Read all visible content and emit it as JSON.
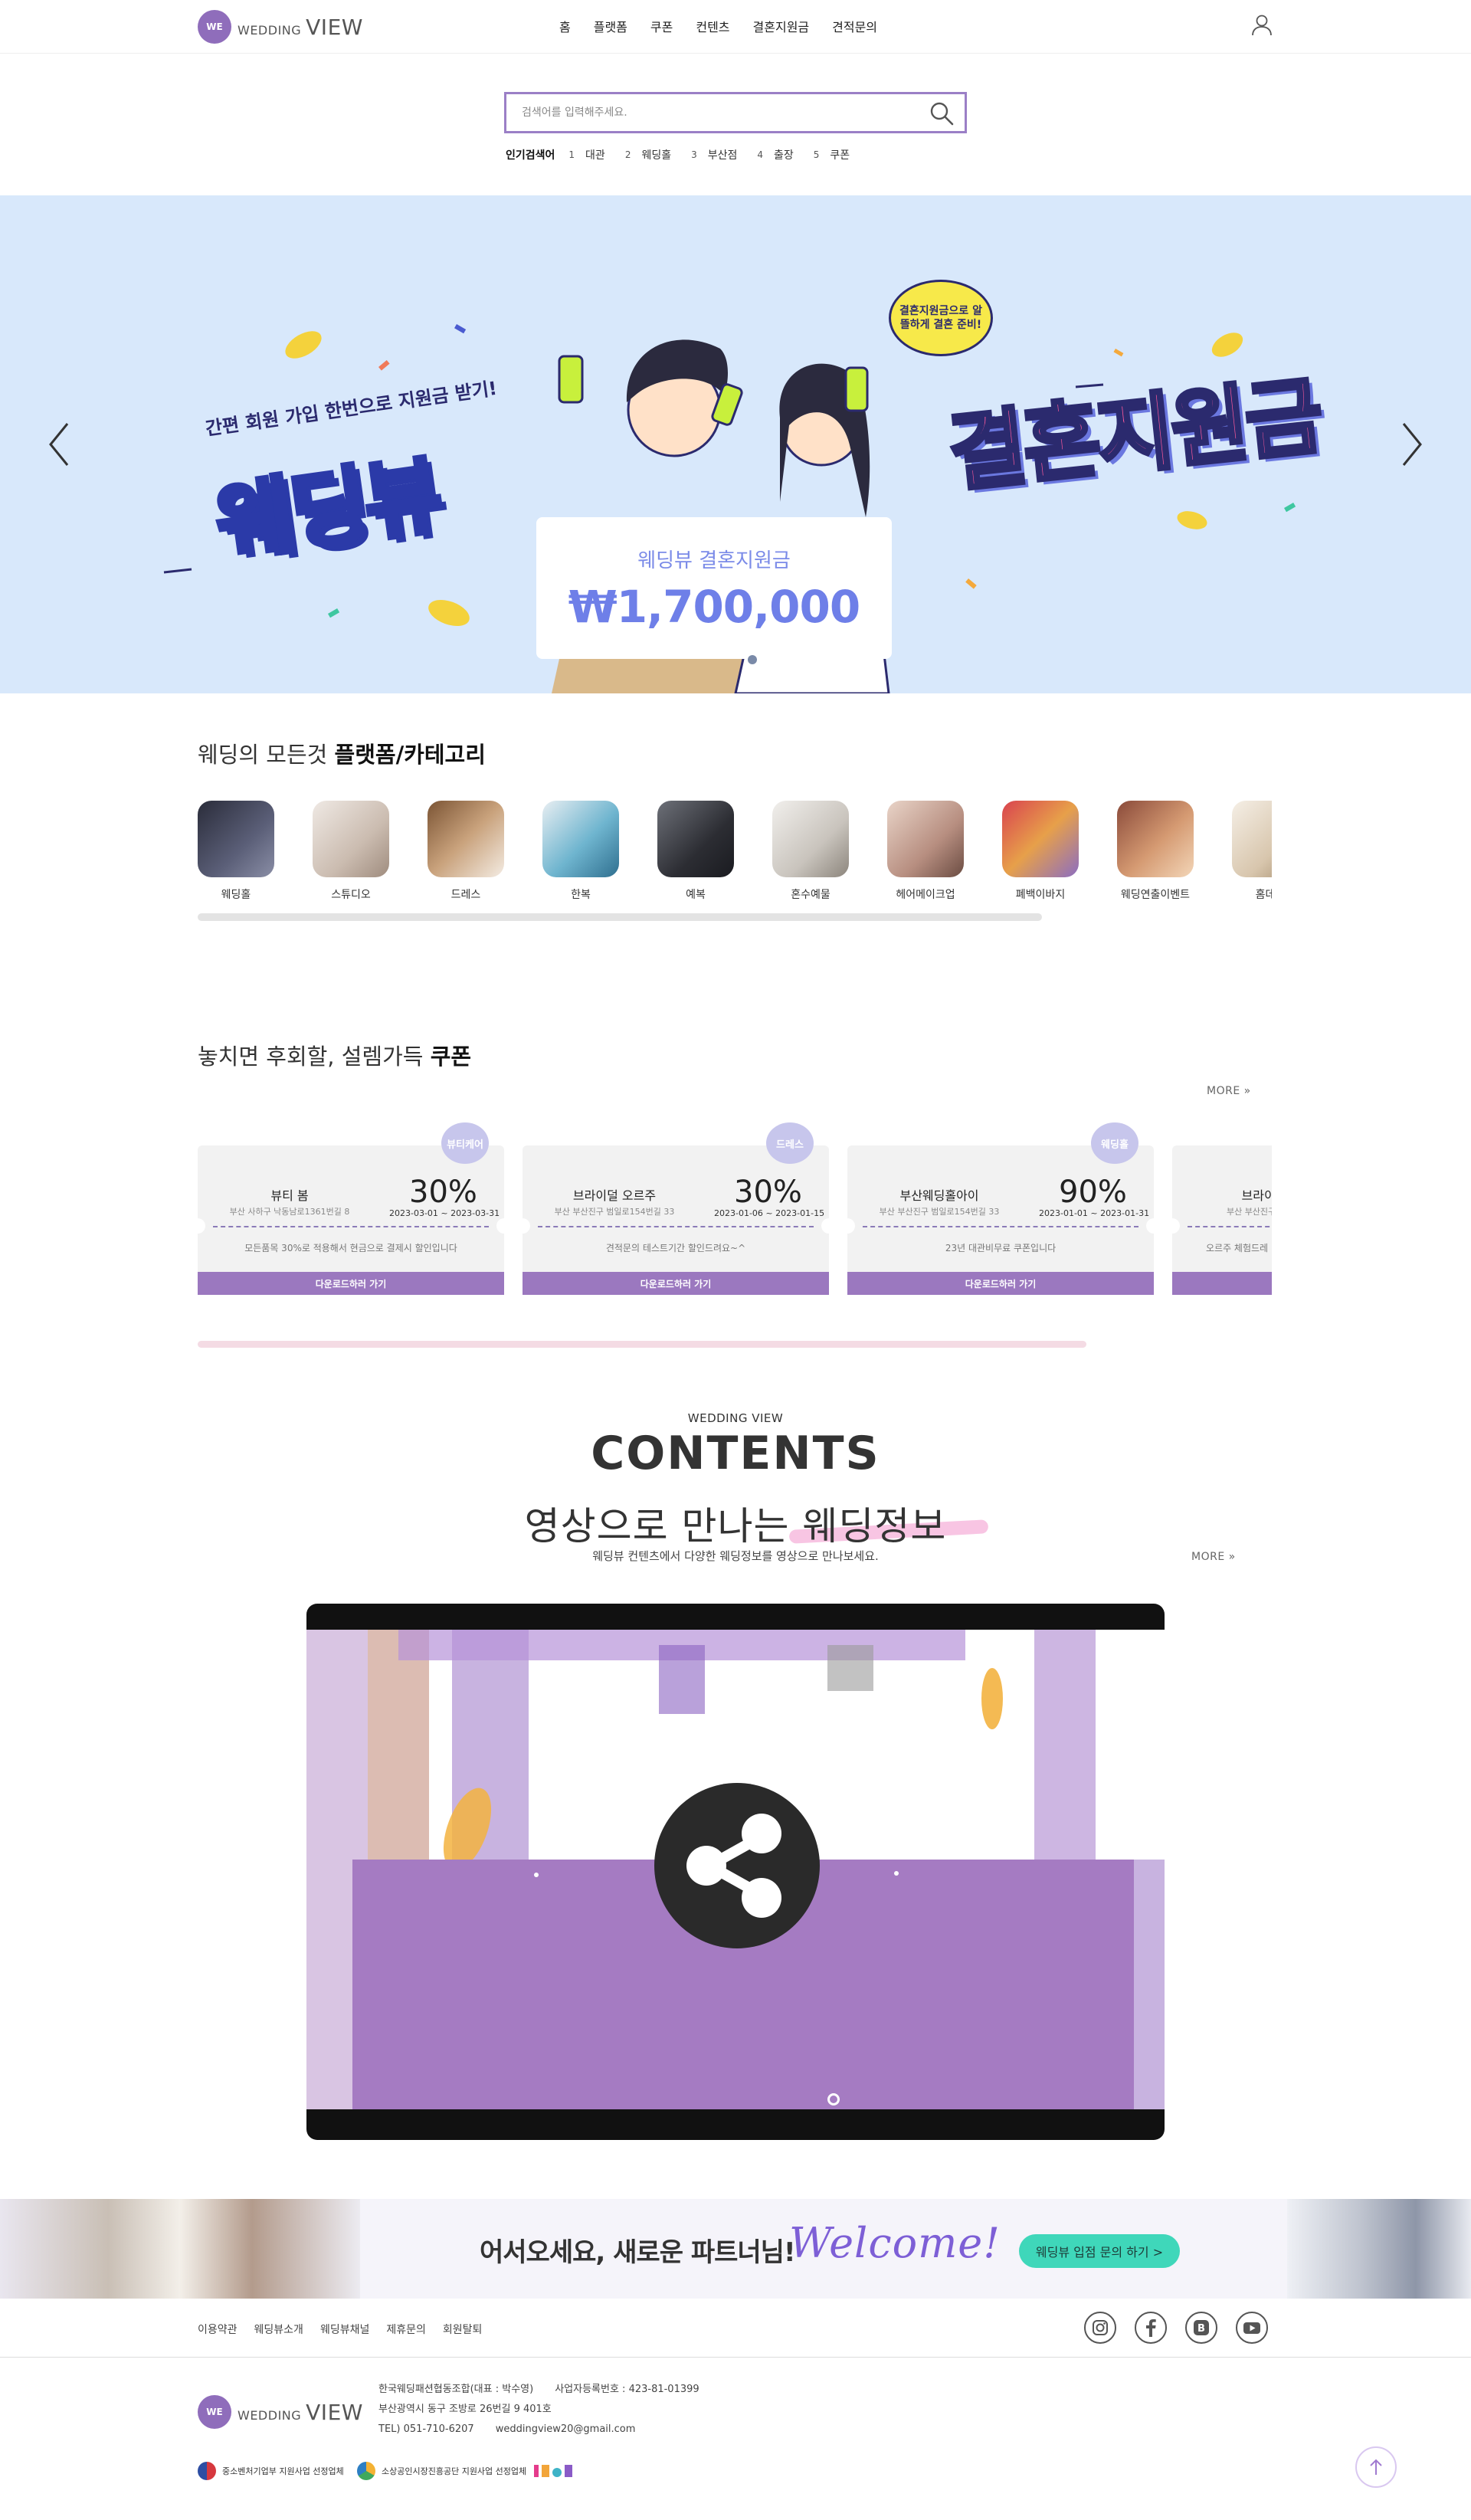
{
  "header": {
    "logo_mark": "WE",
    "logo_word_1": "WEDDING",
    "logo_word_2": "VIEW",
    "nav": [
      "홈",
      "플랫폼",
      "쿠폰",
      "컨텐츠",
      "결혼지원금",
      "견적문의"
    ]
  },
  "search": {
    "placeholder": "검색어를 입력해주세요.",
    "popular_label": "인기검색어",
    "keywords": [
      {
        "rank": "1",
        "text": "대관"
      },
      {
        "rank": "2",
        "text": "웨딩홀"
      },
      {
        "rank": "3",
        "text": "부산점"
      },
      {
        "rank": "4",
        "text": "출장"
      },
      {
        "rank": "5",
        "text": "쿠폰"
      }
    ]
  },
  "hero": {
    "subtitle": "간편 회원 가입 한번으로 지원금 받기!",
    "title_left": "웨딩뷰",
    "title_right": "결혼지원금",
    "bubble": "결혼지원금으로 알뜰하게 결혼 준비!",
    "ticket_label": "웨딩뷰 결혼지원금",
    "ticket_amount": "₩1,700,000",
    "colors": {
      "background": "#d8e8fb",
      "accent": "#6e7fe8",
      "pink": "#ff5a9c"
    }
  },
  "platform": {
    "title_prefix": "웨딩의 모든것",
    "title_bold": "플랫폼/카테고리",
    "categories": [
      {
        "label": "웨딩홀",
        "color": "#3c3f55"
      },
      {
        "label": "스튜디오",
        "color": "#d8cfc8"
      },
      {
        "label": "드레스",
        "color": "#b68a63"
      },
      {
        "label": "한복",
        "color": "#6fb5cf"
      },
      {
        "label": "예복",
        "color": "#34353d"
      },
      {
        "label": "혼수예물",
        "color": "#cfcbc5"
      },
      {
        "label": "헤어메이크업",
        "color": "#c7a59a"
      },
      {
        "label": "폐백이바지",
        "color": "#c9555b"
      },
      {
        "label": "웨딩연출이벤트",
        "color": "#c57b63"
      },
      {
        "label": "홈데코",
        "color": "#e7ddd0"
      }
    ]
  },
  "coupons": {
    "title_prefix": "놓치면 후회할, 설렘가득",
    "title_bold": "쿠폰",
    "more": "MORE",
    "items": [
      {
        "badge": "뷰티케어",
        "name": "뷰티 봄",
        "address": "부산 사하구 낙동남로1361번길 8",
        "rate": "30%",
        "period": "2023-03-01 ~ 2023-03-31",
        "desc": "모든품목 30%로 적용해서 현금으로 결제시 할인입니다",
        "button": "다운로드하러 가기"
      },
      {
        "badge": "드레스",
        "name": "브라이덜 오르주",
        "address": "부산 부산진구 범일로154번길 33",
        "rate": "30%",
        "period": "2023-01-06 ~ 2023-01-15",
        "desc": "견적문의 테스트기간 할인드려요~^",
        "button": "다운로드하러 가기"
      },
      {
        "badge": "웨딩홀",
        "name": "부산웨딩홀아이",
        "address": "부산 부산진구 범일로154번길 33",
        "rate": "90%",
        "period": "2023-01-01 ~ 2023-01-31",
        "desc": "23년 대관비무료 쿠폰입니다",
        "button": "다운로드하러 가기"
      },
      {
        "badge": "",
        "name": "브라이덜",
        "address": "부산 부산진구 범일로",
        "rate": "",
        "period": "",
        "desc": "오르주 체험드레",
        "button": "다운로드하러 가기"
      }
    ]
  },
  "contents": {
    "eyebrow": "WEDDING VIEW",
    "title": "CONTENTS",
    "subtitle": "영상으로 만나는 웨딩정보",
    "description": "웨딩뷰 컨텐츠에서 다양한 웨딩정보를 영상으로 만나보세요.",
    "more": "MORE"
  },
  "partner": {
    "text": "어서오세요, 새로운 파트너님!",
    "script": "Welcome!",
    "button": "웨딩뷰 입점 문의 하기 >"
  },
  "footer": {
    "links": [
      "이용약관",
      "웨딩뷰소개",
      "웨딩뷰채널",
      "제휴문의",
      "회원탈퇴"
    ],
    "sns": [
      "instagram-icon",
      "facebook-icon",
      "blog-icon",
      "youtube-icon"
    ],
    "company": "한국웨딩패션협동조합(대표 : 박수영)",
    "business_no": "사업자등록번호 : 423-81-01399",
    "address": "부산광역시 동구 조방로 26번길 9 401호",
    "tel": "TEL) 051-710-6207",
    "email": "weddingview20@gmail.com",
    "cert_1": "중소벤처기업부 지원사업 선정업체",
    "cert_2": "소상공인시장진흥공단 지원사업 선정업체"
  }
}
